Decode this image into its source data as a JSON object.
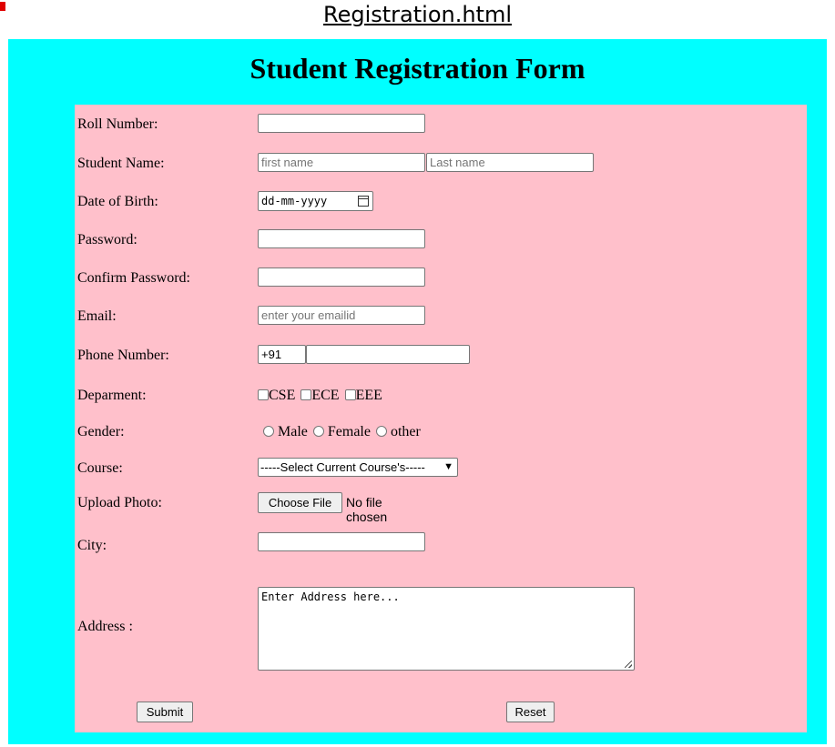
{
  "page": {
    "file_title": "Registration.html"
  },
  "form": {
    "heading": "Student Registration Form",
    "roll_number": {
      "label": "Roll Number:",
      "value": ""
    },
    "student_name": {
      "label": "Student Name:",
      "first_placeholder": "first name",
      "last_placeholder": "Last name"
    },
    "dob": {
      "label": "Date of Birth:",
      "placeholder": "dd-mm-yyyy"
    },
    "password": {
      "label": "Password:",
      "value": ""
    },
    "confirm_password": {
      "label": "Confirm Password:",
      "value": ""
    },
    "email": {
      "label": "Email:",
      "placeholder": "enter your emailid"
    },
    "phone": {
      "label": "Phone Number:",
      "code": "+91",
      "value": ""
    },
    "department": {
      "label": "Deparment:",
      "options": [
        "CSE",
        "ECE",
        "EEE"
      ]
    },
    "gender": {
      "label": "Gender:",
      "options": [
        "Male",
        "Female",
        "other"
      ]
    },
    "course": {
      "label": "Course:",
      "selected": "-----Select Current Course's-----"
    },
    "photo": {
      "label": "Upload Photo:",
      "button": "Choose File",
      "status": "No file chosen"
    },
    "city": {
      "label": "City:",
      "value": ""
    },
    "address": {
      "label": "Address :",
      "placeholder": "Enter Address here..."
    },
    "submit_label": "Submit",
    "reset_label": "Reset"
  },
  "colors": {
    "outer_bg": "#00ffff",
    "form_bg": "#ffc0cb",
    "accent_mark": "#e00000"
  }
}
